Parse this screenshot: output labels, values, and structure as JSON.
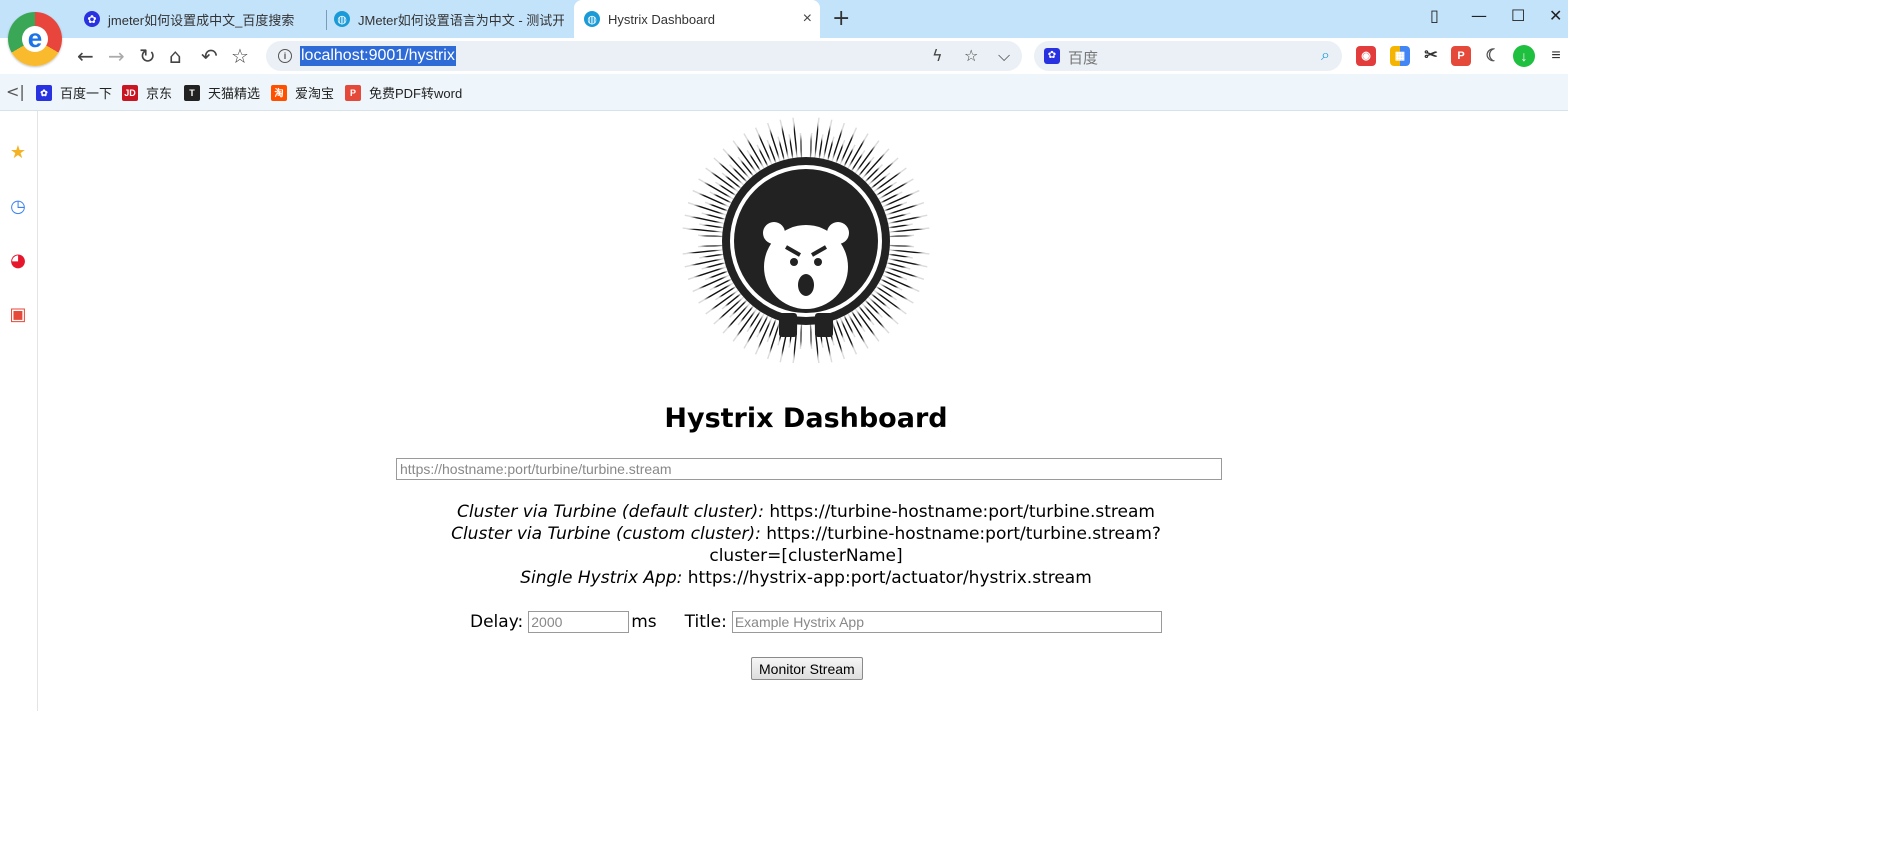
{
  "browser": {
    "logo_letter": "e",
    "tabs": [
      {
        "title": "jmeter如何设置成中文_百度搜索",
        "favicon": "baidu-paw-icon",
        "active": false
      },
      {
        "title": "JMeter如何设置语言为中文 - 测试开",
        "favicon": "globe-icon",
        "active": false
      },
      {
        "title": "Hystrix Dashboard",
        "favicon": "globe-icon",
        "active": true
      }
    ],
    "tab_close_label": "×",
    "new_tab_label": "+",
    "window_controls": {
      "tile": "▯",
      "minimize": "—",
      "maximize": "☐",
      "close": "✕"
    },
    "address_url": "localhost:9001/hystrix",
    "search_placeholder": "百度",
    "bookmarks": [
      {
        "label": "百度一下",
        "icon": "baidu-paw-icon",
        "color": "#2932e1"
      },
      {
        "label": "京东",
        "icon": "jd-icon",
        "color": "#c91623"
      },
      {
        "label": "天猫精选",
        "icon": "tmall-icon",
        "color": "#222222"
      },
      {
        "label": "爱淘宝",
        "icon": "taobao-icon",
        "color": "#ff5000"
      },
      {
        "label": "免费PDF转word",
        "icon": "pdf-icon",
        "color": "#e5493a"
      }
    ]
  },
  "page": {
    "title": "Hystrix Dashboard",
    "stream_placeholder": "https://hostname:port/turbine/turbine.stream",
    "examples": [
      {
        "label": "Cluster via Turbine (default cluster):",
        "value": "https://turbine-hostname:port/turbine.stream"
      },
      {
        "label": "Cluster via Turbine (custom cluster):",
        "value": "https://turbine-hostname:port/turbine.stream?cluster=[clusterName]"
      },
      {
        "label": "Single Hystrix App:",
        "value": "https://hystrix-app:port/actuator/hystrix.stream"
      }
    ],
    "delay_label": "Delay:",
    "delay_placeholder": "2000",
    "delay_unit": "ms",
    "title_label": "Title:",
    "title_placeholder": "Example Hystrix App",
    "monitor_button": "Monitor Stream"
  },
  "colors": {
    "tabstrip_bg": "#c3e3fb",
    "url_highlight": "#2e6bd6",
    "accent_green": "#1fbf3f"
  }
}
